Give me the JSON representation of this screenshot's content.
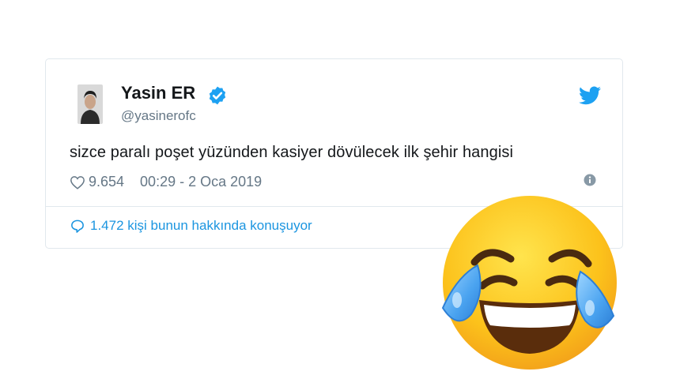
{
  "tweet": {
    "display_name": "Yasin ER",
    "handle": "@yasinerofc",
    "text": "sizce paralı poşet yüzünden kasiyer dövülecek ilk şehir hangisi",
    "likes": "9.654",
    "timestamp": "00:29 - 2 Oca 2019",
    "replies_text": "1.472 kişi bunun hakkında konuşuyor"
  },
  "icons": {
    "verified": "verified-badge-icon",
    "brand": "twitter-bird-icon",
    "like": "heart-icon",
    "info": "info-icon",
    "reply": "speech-bubble-icon",
    "overlay": "face-with-tears-of-joy-emoji"
  },
  "colors": {
    "accent": "#1da1f2",
    "link": "#1b95e0",
    "secondary_text": "#657786",
    "border": "#e1e8ed"
  }
}
